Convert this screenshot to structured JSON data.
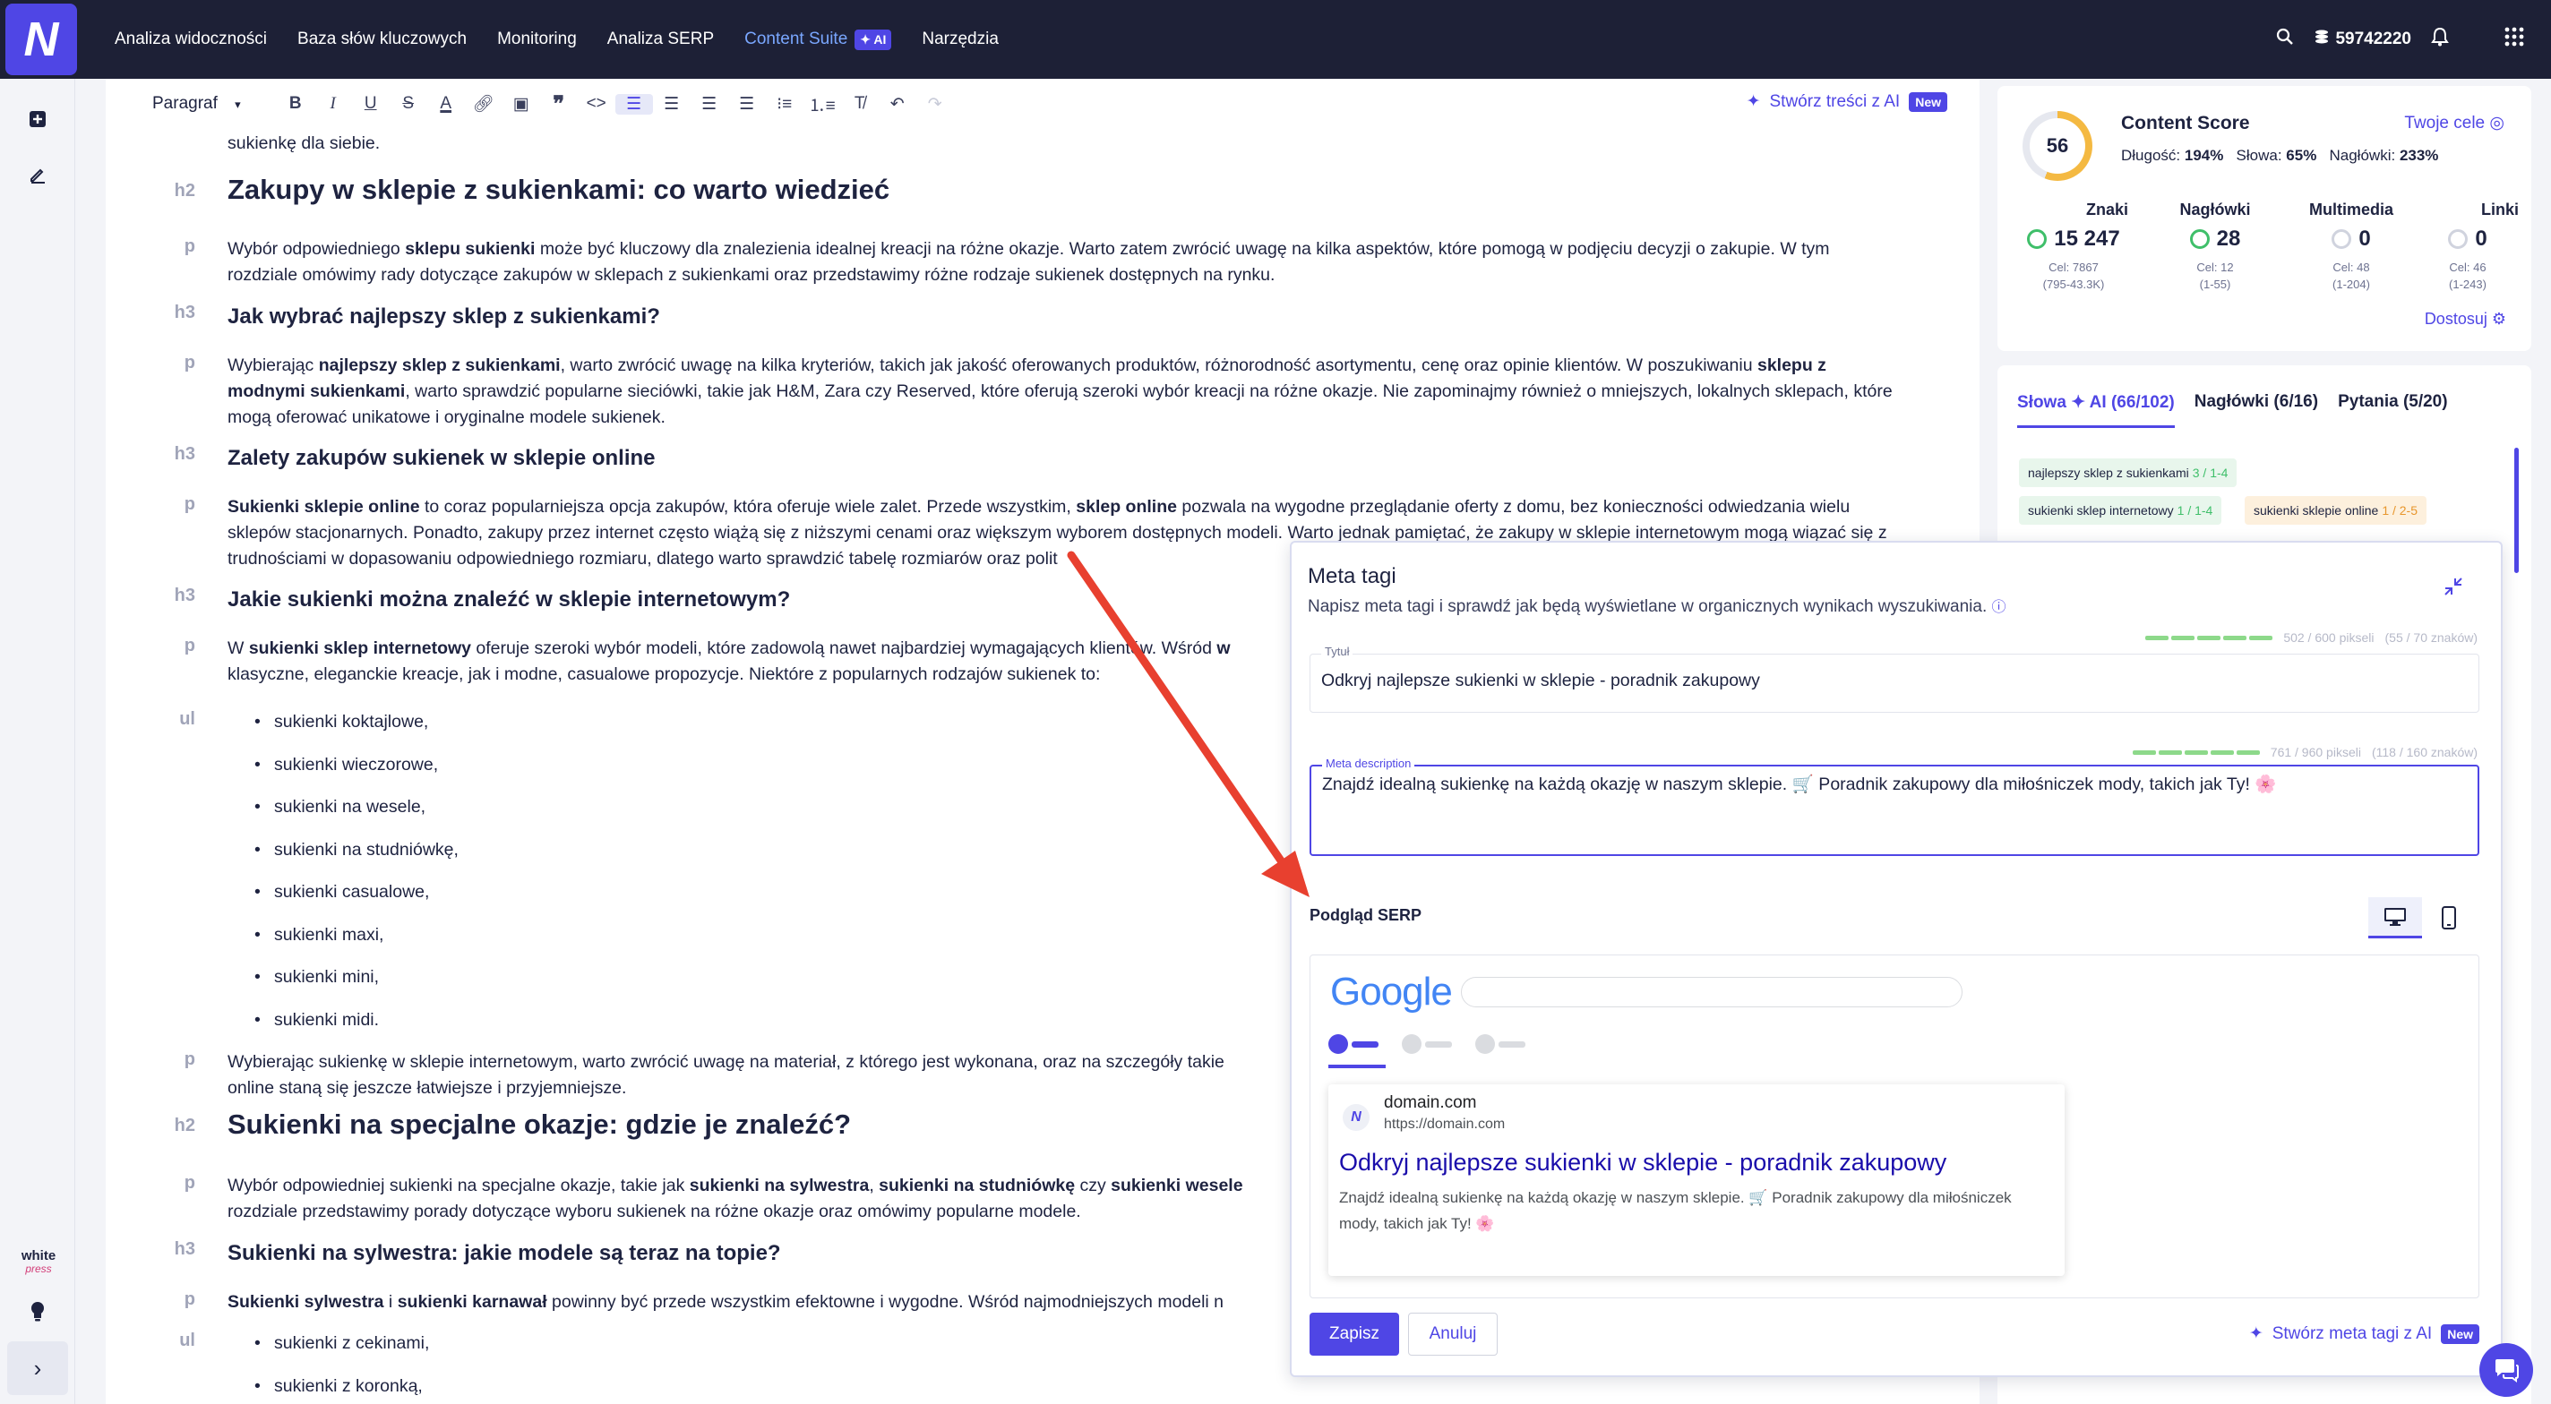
{
  "nav": {
    "items": [
      "Analiza widoczności",
      "Baza słów kluczowych",
      "Monitoring",
      "Analiza SERP",
      "Content Suite",
      "Narzędzia"
    ],
    "ai_badge": "✦ AI",
    "credits": "59742220"
  },
  "toolbar": {
    "paragraph_select": "Paragraf",
    "ai_button": "Stwórz treści z AI",
    "new_badge": "New"
  },
  "sidebar": {
    "wp_logo_top": "white",
    "wp_logo_bottom": "press"
  },
  "content": {
    "top_fragment": "sukienkę dla siebie.",
    "h2_1": "Zakupy w sklepie z sukienkami: co warto wiedzieć",
    "p1_a": "Wybór odpowiedniego ",
    "p1_b": "sklepu sukienki",
    "p1_c": " może być kluczowy dla znalezienia idealnej kreacji na różne okazje. Warto zatem zwrócić uwagę na kilka aspektów, które pomogą w podjęciu decyzji o zakupie. W tym rozdziale omówimy rady dotyczące zakupów w sklepach z sukienkami oraz przedstawimy różne rodzaje sukienek dostępnych na rynku.",
    "h3_1": "Jak wybrać najlepszy sklep z sukienkami?",
    "p2_a": "Wybierając ",
    "p2_b": "najlepszy sklep z sukienkami",
    "p2_c": ", warto zwrócić uwagę na kilka kryteriów, takich jak jakość oferowanych produktów, różnorodność asortymentu, cenę oraz opinie klientów. W poszukiwaniu ",
    "p2_d": "sklepu z modnymi sukienkami",
    "p2_e": ", warto sprawdzić popularne sieciówki, takie jak H&M, Zara czy Reserved, które oferują szeroki wybór kreacji na różne okazje. Nie zapominajmy również o mniejszych, lokalnych sklepach, które mogą oferować unikatowe i oryginalne modele sukienek.",
    "h3_2": "Zalety zakupów sukienek w sklepie online",
    "p3_a": "Sukienki sklepie online",
    "p3_b": " to coraz popularniejsza opcja zakupów, która oferuje wiele zalet. Przede wszystkim, ",
    "p3_c": "sklep online",
    "p3_d": " pozwala na wygodne przeglądanie oferty z domu, bez konieczności odwiedzania wielu sklepów stacjonarnych. Ponadto, zakupy przez internet często wiążą się z niższymi cenami oraz większym wyborem dostępnych modeli. Warto jednak pamiętać, że zakupy w sklepie internetowym mogą wiązać się z trudnościami w dopasowaniu odpowiedniego rozmiaru, dlatego warto sprawdzić tabelę rozmiarów oraz polit",
    "h3_3": "Jakie sukienki można znaleźć w sklepie internetowym?",
    "p4_a": "W ",
    "p4_b": "sukienki sklep internetowy",
    "p4_c": " oferuje szeroki wybór modeli, które zadowolą nawet najbardziej wymagających klientów. Wśród ",
    "p4_d": "w",
    "p4_e": "klasyczne, eleganckie kreacje, jak i modne, casualowe propozycje. Niektóre z popularnych rodzajów sukienek to:",
    "list1": [
      "sukienki koktajlowe,",
      "sukienki wieczorowe,",
      "sukienki na wesele,",
      "sukienki na studniówkę,",
      "sukienki casualowe,",
      "sukienki maxi,",
      "sukienki mini,",
      "sukienki midi."
    ],
    "p5_a": "Wybierając sukienkę w sklepie internetowym, warto zwrócić uwagę na materiał, z którego jest wykonana, oraz na szczegóły takie",
    "p5_b": "online staną się jeszcze łatwiejsze i przyjemniejsze.",
    "h2_2": "Sukienki na specjalne okazje: gdzie je znaleźć?",
    "p6_a": "Wybór odpowiedniej sukienki na specjalne okazje, takie jak ",
    "p6_b": "sukienki na sylwestra",
    "p6_c": ", ",
    "p6_d": "sukienki na studniówkę",
    "p6_e": " czy ",
    "p6_f": "sukienki wesele",
    "p6_g": "rozdziale przedstawimy porady dotyczące wyboru sukienek na różne okazje oraz omówimy popularne modele.",
    "h3_4": "Sukienki na sylwestra: jakie modele są teraz na topie?",
    "p7_a": "Sukienki sylwestra",
    "p7_b": " i ",
    "p7_c": "sukienki karnawał",
    "p7_d": " powinny być przede wszystkim efektowne i wygodne. Wśród najmodniejszych modeli n",
    "list2": [
      "sukienki z cekinami,",
      "sukienki z koronką,"
    ]
  },
  "tags": {
    "h2": "h2",
    "h3": "h3",
    "p": "p",
    "ul": "ul"
  },
  "score": {
    "value": "56",
    "title": "Content Score",
    "goals_link": "Twoje cele",
    "length_label": "Długość:",
    "length_value": "194%",
    "words_label": "Słowa:",
    "words_value": "65%",
    "headings_label": "Nagłówki:",
    "headings_value": "233%",
    "metrics": [
      {
        "label": "Znaki",
        "value": "15 247",
        "goal": "Cel: 7867",
        "range": "(795-43.3K)"
      },
      {
        "label": "Nagłówki",
        "value": "28",
        "goal": "Cel: 12",
        "range": "(1-55)"
      },
      {
        "label": "Multimedia",
        "value": "0",
        "goal": "Cel: 48",
        "range": "(1-204)"
      },
      {
        "label": "Linki",
        "value": "0",
        "goal": "Cel: 46",
        "range": "(1-243)"
      }
    ],
    "customize": "Dostosuj"
  },
  "keywords": {
    "tab_words": "Słowa",
    "tab_words_ai": "✦ AI",
    "tab_words_count": "(66/102)",
    "tab_headings": "Nagłówki (6/16)",
    "tab_questions": "Pytania (5/20)",
    "chips": [
      {
        "text": "najlepszy sklep z sukienkami",
        "count": "3 / 1-4"
      },
      {
        "text": "sukienki sklep internetowy",
        "count": "1 / 1-4"
      },
      {
        "text": "sukienki sklepie online",
        "count": "1 / 2-5"
      }
    ]
  },
  "meta": {
    "title": "Meta tagi",
    "subtitle": "Napisz meta tagi i sprawdź jak będą wyświetlane w organicznych wynikach wyszukiwania.",
    "title_pixels": "502 / 600 pikseli",
    "title_chars": "(55 / 70 znaków)",
    "title_label": "Tytuł",
    "title_value": "Odkryj najlepsze sukienki w sklepie - poradnik zakupowy",
    "desc_pixels": "761 / 960 pikseli",
    "desc_chars": "(118 / 160 znaków)",
    "desc_label": "Meta description",
    "desc_value": "Znajdź idealną sukienkę na każdą okazję w naszym sklepie. 🛒 Poradnik zakupowy dla miłośniczek mody, takich jak Ty! 🌸",
    "serp_label": "Podgląd SERP",
    "google_logo": "Google",
    "result_domain": "domain.com",
    "result_url": "https://domain.com",
    "result_title": "Odkryj najlepsze sukienki w sklepie - poradnik zakupowy",
    "result_desc": "Znajdź idealną sukienkę na każdą okazję w naszym sklepie. 🛒 Poradnik zakupowy dla miłośniczek mody, takich jak Ty! 🌸",
    "save": "Zapisz",
    "cancel": "Anuluj",
    "ai_button": "Stwórz meta tagi z AI",
    "new_badge": "New"
  },
  "colors": {
    "accent": "#4f46e5",
    "topbar": "#1d2036",
    "green": "#3fbf6a",
    "orange": "#e8962c",
    "arrow": "#e8402f"
  }
}
